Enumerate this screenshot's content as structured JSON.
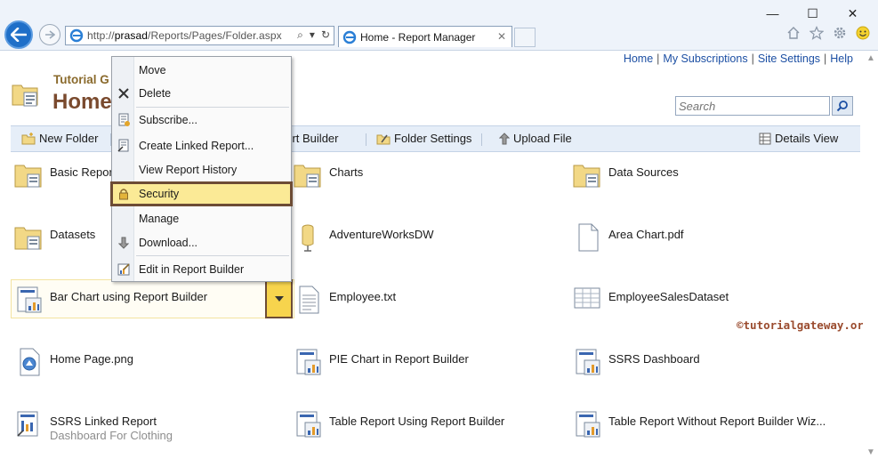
{
  "browser": {
    "url_prefix": "http://",
    "url_host": "prasad",
    "url_path": "/Reports/Pages/Folder.aspx",
    "tab_title": "Home - Report Manager",
    "tab_close": "✕",
    "window_controls": [
      "—",
      "☐",
      "✕"
    ],
    "addr_tools": [
      "⌕",
      "▾",
      "↻"
    ]
  },
  "toplinks": [
    "Home",
    "My Subscriptions",
    "Site Settings",
    "Help"
  ],
  "header": {
    "site_name": "Tutorial G",
    "page_title": "Home"
  },
  "search": {
    "placeholder": "Search"
  },
  "actions": {
    "new_folder": "New Folder",
    "report_builder": "port Builder",
    "folder_settings": "Folder Settings",
    "upload_file": "Upload File",
    "details_view": "Details View"
  },
  "items": [
    {
      "label": "Basic Repor",
      "icon": "folder-icon"
    },
    {
      "label": "Charts",
      "icon": "folder-icon"
    },
    {
      "label": "Data Sources",
      "icon": "folder-icon"
    },
    {
      "label": "Datasets",
      "icon": "folder-icon"
    },
    {
      "label": "AdventureWorksDW",
      "icon": "datasource-icon"
    },
    {
      "label": "Area Chart.pdf",
      "icon": "document-icon"
    },
    {
      "label": "Bar Chart using Report Builder",
      "icon": "report-icon"
    },
    {
      "label": "Employee.txt",
      "icon": "text-file-icon"
    },
    {
      "label": "EmployeeSalesDataset",
      "icon": "dataset-icon"
    },
    {
      "label": "Home Page.png",
      "icon": "image-file-icon"
    },
    {
      "label": "PIE Chart in Report Builder",
      "icon": "report-icon"
    },
    {
      "label": "SSRS Dashboard",
      "icon": "report-icon"
    },
    {
      "label": "SSRS Linked Report",
      "sublabel": "Dashboard For Clothing",
      "icon": "linked-report-icon"
    },
    {
      "label": "Table Report Using Report Builder",
      "icon": "report-icon"
    },
    {
      "label": "Table Report Without Report Builder Wiz...",
      "icon": "report-icon"
    }
  ],
  "context_menu": {
    "items": [
      "Move",
      "Delete",
      "Subscribe...",
      "Create Linked Report...",
      "View Report History",
      "Security",
      "Manage",
      "Download...",
      "Edit in Report Builder"
    ],
    "highlighted": "Security"
  },
  "watermark": "©tutorialgateway.org",
  "colors": {
    "accent_brown": "#7a4a2e",
    "highlight_yellow": "#fbea96",
    "link_blue": "#1c4fa3",
    "action_bar": "#e6eef8"
  }
}
